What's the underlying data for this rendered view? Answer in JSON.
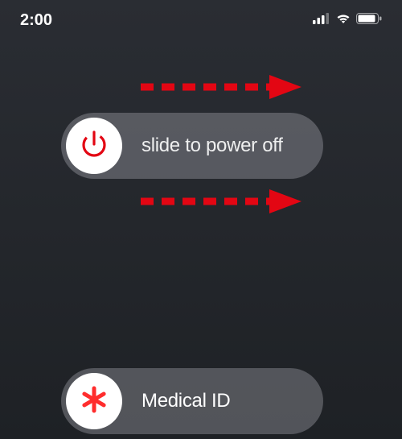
{
  "status_bar": {
    "time": "2:00"
  },
  "sliders": {
    "power": {
      "label": "slide to power off"
    },
    "medical": {
      "label": "Medical ID"
    }
  },
  "colors": {
    "accent_red": "#e30613",
    "asterisk_red": "#ff2d2d"
  }
}
